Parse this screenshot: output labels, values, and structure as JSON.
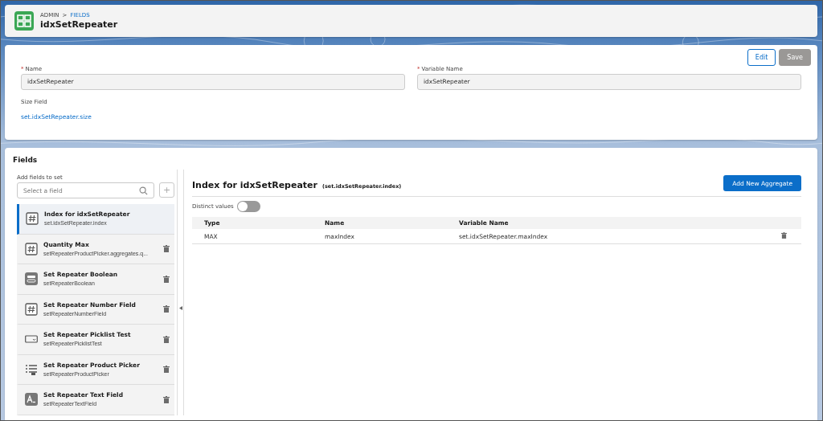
{
  "header": {
    "breadcrumb": [
      {
        "label": "ADMIN",
        "link": false
      },
      {
        "label": "FIELDS",
        "link": true
      }
    ],
    "separator": ">",
    "title": "idxSetRepeater"
  },
  "details": {
    "buttons": [
      {
        "label": "Edit",
        "disabled": false
      },
      {
        "label": "Save",
        "disabled": true
      }
    ],
    "fields": [
      {
        "label": "Name",
        "required": true,
        "value": "idxSetRepeater"
      },
      {
        "label": "Variable Name",
        "required": true,
        "value": "idxSetRepeater"
      }
    ],
    "required_mark": "*",
    "size_field": {
      "label": "Size Field",
      "value": "set.idxSetRepeater.size"
    }
  },
  "fields_panel": {
    "title": "Fields",
    "add_label": "Add fields to set",
    "search": {
      "placeholder": "Select a field"
    },
    "add_button": "+",
    "items": [
      {
        "kind": "number",
        "name": "Index for idxSetRepeater",
        "variable": "set.idxSetRepeater.index",
        "selected": true,
        "deletable": false
      },
      {
        "kind": "number",
        "name": "Quantity Max",
        "variable": "setRepeaterProductPicker.aggregates.q...",
        "selected": false,
        "deletable": true
      },
      {
        "kind": "boolean",
        "name": "Set Repeater Boolean",
        "variable": "setRepeaterBoolean",
        "selected": false,
        "deletable": true
      },
      {
        "kind": "number",
        "name": "Set Repeater Number Field",
        "variable": "setRepeaterNumberField",
        "selected": false,
        "deletable": true
      },
      {
        "kind": "picklist",
        "name": "Set Repeater Picklist Test",
        "variable": "setRepeaterPicklistTest",
        "selected": false,
        "deletable": true
      },
      {
        "kind": "list",
        "name": "Set Repeater Product Picker",
        "variable": "setRepeaterProductPicker",
        "selected": false,
        "deletable": true
      },
      {
        "kind": "text",
        "name": "Set Repeater Text Field",
        "variable": "setRepeaterTextField",
        "selected": false,
        "deletable": true
      }
    ],
    "detail": {
      "title": "Index for idxSetRepeater",
      "subtitle": "(set.idxSetRepeater.index)",
      "button": "Add New Aggregate",
      "toggle": {
        "label": "Distinct values",
        "on": false
      },
      "table": {
        "columns": [
          "Type",
          "Name",
          "Variable Name"
        ],
        "rows": [
          {
            "cells": [
              "MAX",
              "maxIndex",
              "set.idxSetRepeater.maxIndex"
            ],
            "deletable": true
          }
        ]
      }
    }
  }
}
